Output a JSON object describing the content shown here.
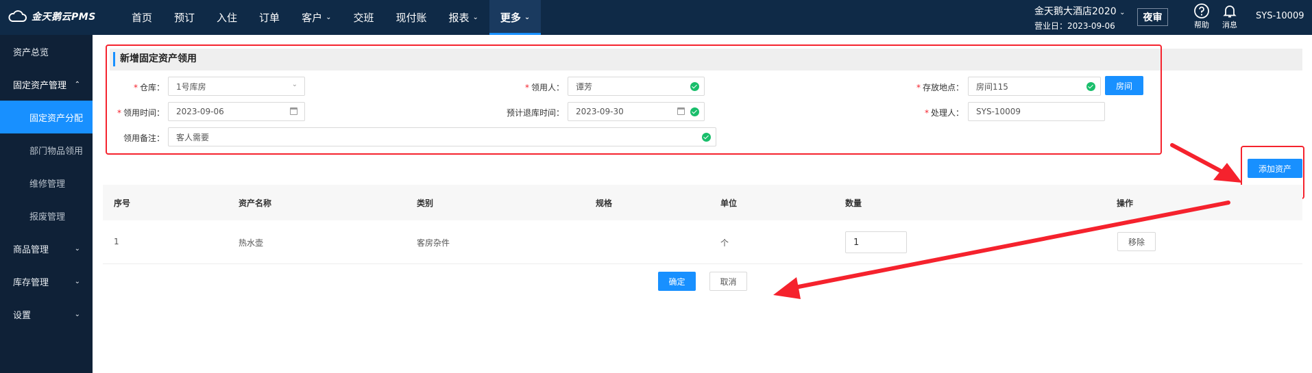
{
  "header": {
    "logo_text": "金天鹅云PMS",
    "nav": [
      {
        "label": "首页"
      },
      {
        "label": "预订"
      },
      {
        "label": "入住"
      },
      {
        "label": "订单"
      },
      {
        "label": "客户",
        "dropdown": true
      },
      {
        "label": "交班"
      },
      {
        "label": "现付账"
      },
      {
        "label": "报表",
        "dropdown": true
      },
      {
        "label": "更多",
        "dropdown": true,
        "active": true
      }
    ],
    "hotel_name": "金天鹅大酒店2020",
    "business_date": "营业日：2023-09-06",
    "night_audit": "夜审",
    "help": "帮助",
    "messages": "消息",
    "user": "SYS-10009"
  },
  "sidebar": {
    "items": [
      {
        "label": "资产总览"
      },
      {
        "label": "固定资产管理"
      },
      {
        "label": "固定资产分配"
      },
      {
        "label": "部门物品领用"
      },
      {
        "label": "维修管理"
      },
      {
        "label": "报废管理"
      },
      {
        "label": "商品管理"
      },
      {
        "label": "库存管理"
      },
      {
        "label": "设置"
      }
    ]
  },
  "form": {
    "title": "新增固定资产领用",
    "warehouse": {
      "label": "仓库：",
      "value": "1号库房"
    },
    "recipient": {
      "label": "领用人：",
      "value": "谭芳"
    },
    "location": {
      "label": "存放地点：",
      "value": "房间115",
      "button": "房间"
    },
    "use_time": {
      "label": "领用时间：",
      "value": "2023-09-06"
    },
    "return_time": {
      "label": "预计退库时间：",
      "value": "2023-09-30"
    },
    "handler": {
      "label": "处理人：",
      "value": "SYS-10009"
    },
    "remark": {
      "label": "领用备注：",
      "value": "客人需要"
    },
    "add_asset": "添加资产"
  },
  "table": {
    "headers": [
      "序号",
      "资产名称",
      "类别",
      "规格",
      "单位",
      "数量",
      "操作"
    ],
    "rows": [
      {
        "no": "1",
        "name": "热水壶",
        "category": "客房杂件",
        "spec": "",
        "unit": "个",
        "qty": "1",
        "action": "移除"
      }
    ]
  },
  "footer": {
    "confirm": "确定",
    "cancel": "取消"
  },
  "colors": {
    "accent": "#1890ff",
    "topbar": "#0f2a47",
    "sidebar": "#0f2137",
    "annotation": "#f5222d"
  }
}
